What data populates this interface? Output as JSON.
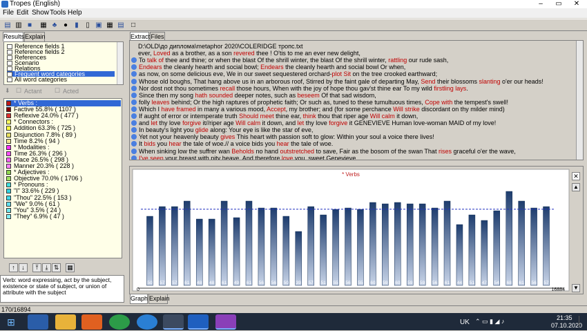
{
  "window": {
    "title": "Tropes (English)",
    "minimize_label": "–",
    "maximize_label": "▭",
    "close_label": "✕"
  },
  "menu": [
    "File",
    "Edit",
    "Show",
    "Tools",
    "Help"
  ],
  "toolbar": [
    "folder-open-icon",
    "printer-icon",
    "save-icon",
    "grid-icon",
    "tree-icon",
    "cluster-icon",
    "chart-icon",
    "stacked-chart-icon",
    "layout-icon",
    "calendar-icon",
    "table-icon",
    "window-icon"
  ],
  "left_tabs": {
    "results": "Results",
    "explain": "Explain"
  },
  "categories": [
    {
      "label": "Reference fields 1",
      "selected": false
    },
    {
      "label": "Reference fields 2",
      "selected": false
    },
    {
      "label": "References",
      "selected": false
    },
    {
      "label": "Scenario",
      "selected": false
    },
    {
      "label": "Relations",
      "selected": false
    },
    {
      "label": "Frequent word categories",
      "selected": true
    },
    {
      "label": "All word categories",
      "selected": false
    }
  ],
  "actor_toggle": {
    "actant": "Actant",
    "acted": "Acted"
  },
  "tree": [
    {
      "label": "* Verbs :",
      "color": "#c01818",
      "selected": true
    },
    {
      "label": "Factive  55.8% ( 1107 )",
      "color": "#800000",
      "selected": false
    },
    {
      "label": "Reflexive  24.0% ( 477 )",
      "color": "#e03030",
      "selected": false
    },
    {
      "label": "* Connectors :",
      "color": "#ffff60",
      "selected": false
    },
    {
      "label": "Addition  63.3% ( 725 )",
      "color": "#ffff40",
      "selected": false
    },
    {
      "label": "Disjunction   7.8% ( 89 )",
      "color": "#e8e060",
      "selected": false
    },
    {
      "label": "Time   8.2% ( 94 )",
      "color": "#f0e890",
      "selected": false
    },
    {
      "label": "* Modalities :",
      "color": "#ff30ff",
      "selected": false
    },
    {
      "label": "Time  26.3% ( 296 )",
      "color": "#ff50ff",
      "selected": false
    },
    {
      "label": "Place  26.5% ( 298 )",
      "color": "#ff60ff",
      "selected": false
    },
    {
      "label": "Manner  20.3% ( 228 )",
      "color": "#ff80ff",
      "selected": false
    },
    {
      "label": "* Adjectives :",
      "color": "#90d850",
      "selected": false
    },
    {
      "label": "Objective  70.0% ( 1706 )",
      "color": "#a0e060",
      "selected": false
    },
    {
      "label": "* Pronouns :",
      "color": "#40e0e0",
      "selected": false
    },
    {
      "label": "\"I\"    33.6% ( 229 )",
      "color": "#30d0e0",
      "selected": false
    },
    {
      "label": "\"Thou\"  22.5% ( 153 )",
      "color": "#40d8e8",
      "selected": false
    },
    {
      "label": "\"We\"   9.0% ( 61 )",
      "color": "#60e0f0",
      "selected": false
    },
    {
      "label": "\"You\"   3.5% ( 24 )",
      "color": "#70e8f0",
      "selected": false
    },
    {
      "label": "\"They\"   6.9% ( 47 )",
      "color": "#80f0f8",
      "selected": false
    }
  ],
  "tree_buttons": [
    "up-arrow-icon",
    "down-arrow-icon",
    "move-up-icon",
    "move-down-icon",
    "merge-icon",
    "save-icon"
  ],
  "definition": "Verb: word expressing, act by the subject, existence or state of subject, or union of attribute with the subject",
  "status": "170/16894",
  "right_tabs": {
    "extract": "Extract",
    "files": "Files"
  },
  "bottom_tabs": {
    "graph": "Graph",
    "explain": "Explain"
  },
  "text_lines": [
    {
      "dot": false,
      "parts": [
        [
          "D:\\OLD\\до диплома\\metaphor 2020\\COLERIDGE тропс.txt",
          false
        ]
      ]
    },
    {
      "dot": false,
      "parts": [
        [
          "ever, ",
          false
        ],
        [
          "Loved",
          true
        ],
        [
          " as a brother,  as a son ",
          false
        ],
        [
          "revered",
          true
        ],
        [
          " thee ! O'tis to me an ever new delight,",
          false
        ]
      ]
    },
    {
      "dot": true,
      "parts": [
        [
          "To ",
          false
        ],
        [
          "talk of",
          true
        ],
        [
          " thee and thine; or when the blast Of the shrill winter, the blast Of the shrill winter, ",
          false
        ],
        [
          "rattling",
          true
        ],
        [
          " our rude sash,",
          false
        ]
      ]
    },
    {
      "dot": true,
      "parts": [
        [
          "Endears",
          true
        ],
        [
          " the cleanly hearth and social bowl; ",
          false
        ],
        [
          "Endears",
          true
        ],
        [
          " the cleanly hearth and social bowl Or when,",
          false
        ]
      ]
    },
    {
      "dot": true,
      "parts": [
        [
          "as now, on some delicious eve, We in our sweet sequestered orchard-",
          false
        ],
        [
          "plot",
          true
        ],
        [
          " ",
          false
        ],
        [
          "Sit",
          true
        ],
        [
          " on the tree crooked earthward;",
          false
        ]
      ]
    },
    {
      "dot": true,
      "parts": [
        [
          "Whose old boughs, That hang above us in an arborous roof, Stirred by the faint gale of departing May, ",
          false
        ],
        [
          "Send",
          true
        ],
        [
          " their blossoms ",
          false
        ],
        [
          "slanting",
          true
        ],
        [
          " o'er our heads!",
          false
        ]
      ]
    },
    {
      "dot": true,
      "parts": [
        [
          "Nor dost not thou sometimes ",
          false
        ],
        [
          "recall",
          true
        ],
        [
          " those hours,  When with the joy of hope thou gav'st thine ear To my wild ",
          false
        ],
        [
          "firstling lays",
          true
        ],
        [
          ".",
          false
        ]
      ]
    },
    {
      "dot": true,
      "parts": [
        [
          "Since then my song ",
          false
        ],
        [
          "hath sounded",
          true
        ],
        [
          " deeper notes,  such as ",
          false
        ],
        [
          "beseem",
          true
        ],
        [
          " Of that sad wisdom,",
          false
        ]
      ]
    },
    {
      "dot": true,
      "parts": [
        [
          "folly ",
          false
        ],
        [
          "leaves",
          true
        ],
        [
          " behind; Or the high raptures of prophetic faith; Or such as, tuned to these tumultuous times, ",
          false
        ],
        [
          "Cope with",
          true
        ],
        [
          " the tempest's swell!",
          false
        ]
      ]
    },
    {
      "dot": true,
      "parts": [
        [
          "Which I ",
          false
        ],
        [
          "have framed",
          true
        ],
        [
          " in many a various mood,  ",
          false
        ],
        [
          "Accept",
          true
        ],
        [
          ", my brother; and (for some perchance ",
          false
        ],
        [
          "Will strike",
          true
        ],
        [
          " discordant on thy milder mind)",
          false
        ]
      ]
    },
    {
      "dot": true,
      "parts": [
        [
          "If aught of error or intemperate truth ",
          false
        ],
        [
          "Should meet",
          true
        ],
        [
          " thine ear,  ",
          false
        ],
        [
          "think",
          true
        ],
        [
          " thou that riper age ",
          false
        ],
        [
          "Will calm",
          true
        ],
        [
          " it down,",
          false
        ]
      ]
    },
    {
      "dot": true,
      "parts": [
        [
          "and ",
          false
        ],
        [
          "let",
          true
        ],
        [
          " thy love ",
          false
        ],
        [
          "forgive",
          true
        ],
        [
          " it//riper age ",
          false
        ],
        [
          "Will calm",
          true
        ],
        [
          " it down,  and ",
          false
        ],
        [
          "let",
          true
        ],
        [
          " thy love ",
          false
        ],
        [
          "forgive",
          true
        ],
        [
          " it GENEVIEVE Human love-woman MAID of my love!",
          false
        ]
      ]
    },
    {
      "dot": true,
      "parts": [
        [
          "In beauty's light you ",
          false
        ],
        [
          "glide",
          true
        ],
        [
          " along: Your eye is like the star of eve,",
          false
        ]
      ]
    },
    {
      "dot": true,
      "parts": [
        [
          "Yet not your heavenly beauty ",
          false
        ],
        [
          "gives",
          true
        ],
        [
          " This heart with passion soft to glow: Within your soul a voice there lives!",
          false
        ]
      ]
    },
    {
      "dot": true,
      "parts": [
        [
          "It ",
          false
        ],
        [
          "bids",
          true
        ],
        [
          " you ",
          false
        ],
        [
          "hear",
          true
        ],
        [
          " the tale of woe.// a voice bids you ",
          false
        ],
        [
          "hear",
          true
        ],
        [
          " the tale of woe.",
          false
        ]
      ]
    },
    {
      "dot": true,
      "parts": [
        [
          "When sinking low the suffrer wan ",
          false
        ],
        [
          "Beholds",
          true
        ],
        [
          " no hand ",
          false
        ],
        [
          "outstretched",
          true
        ],
        [
          " to save, Fair as the bosom of the swan That ",
          false
        ],
        [
          "rises",
          true
        ],
        [
          " graceful o'er the wave,",
          false
        ]
      ]
    },
    {
      "dot": true,
      "parts": [
        [
          "I've seen",
          true
        ],
        [
          " your breast with pity heave,  And therefore ",
          false
        ],
        [
          "love",
          true
        ],
        [
          " you, sweet Genevieve.",
          false
        ]
      ]
    }
  ],
  "chart_data": {
    "type": "bar",
    "title": "* Verbs",
    "values": [
      50,
      57,
      57,
      61,
      48,
      48,
      61,
      49,
      61,
      56,
      56,
      50,
      39,
      57,
      51,
      55,
      56,
      55,
      60,
      59,
      60,
      59,
      59,
      56,
      61,
      44,
      51,
      47,
      54,
      68,
      61,
      56,
      57
    ],
    "labels": [
      "50",
      "57",
      "57",
      "61",
      "48",
      "48",
      "61",
      "49",
      "61",
      "56",
      "56",
      "50",
      "39",
      "57",
      "51",
      "55",
      "56",
      "55",
      "60",
      "59",
      "60",
      "59",
      "59",
      "56",
      "61",
      "44",
      "51",
      "47",
      "54",
      "68",
      "61",
      "56",
      "57"
    ],
    "x_axis_start": "0",
    "x_axis_end": "16884",
    "mean_line": true,
    "bar_color": "#1e3d6e"
  },
  "taskbar": {
    "lang": "UK",
    "time": "21:35",
    "date": "07.10.2020"
  }
}
